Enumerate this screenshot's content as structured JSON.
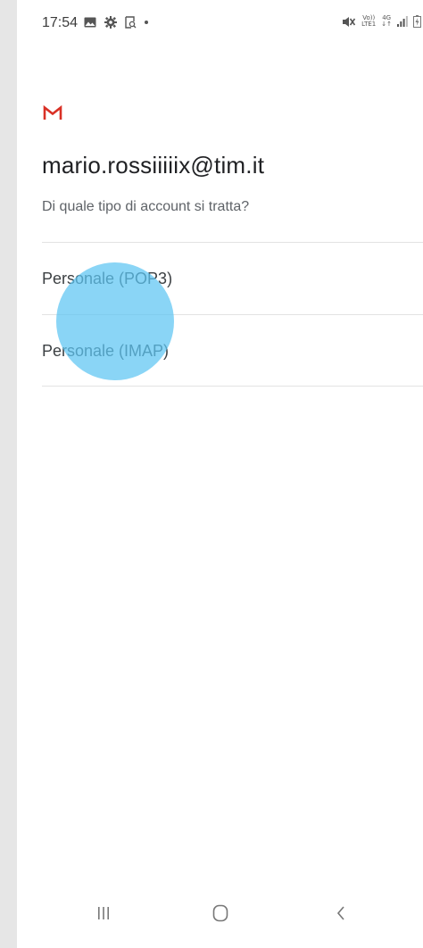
{
  "status_bar": {
    "time": "17:54",
    "signal_labels": {
      "volte_top": "Vo))",
      "volte_bottom": "LTE1",
      "network_top": "4G",
      "network_bottom": "↓↑"
    }
  },
  "app": {
    "logo_icon": "gmail-m-icon",
    "brand_color": "#D93025"
  },
  "account": {
    "email": "mario.rossiiiiix@tim.it",
    "question": "Di quale tipo di account si tratta?"
  },
  "options": [
    {
      "label": "Personale (POP3)"
    },
    {
      "label": "Personale (IMAP)"
    }
  ],
  "touch_indicator_color": "#5DC5F2",
  "navigation": {
    "recent_icon": "recent-apps-icon",
    "home_icon": "home-icon",
    "back_icon": "back-icon"
  }
}
